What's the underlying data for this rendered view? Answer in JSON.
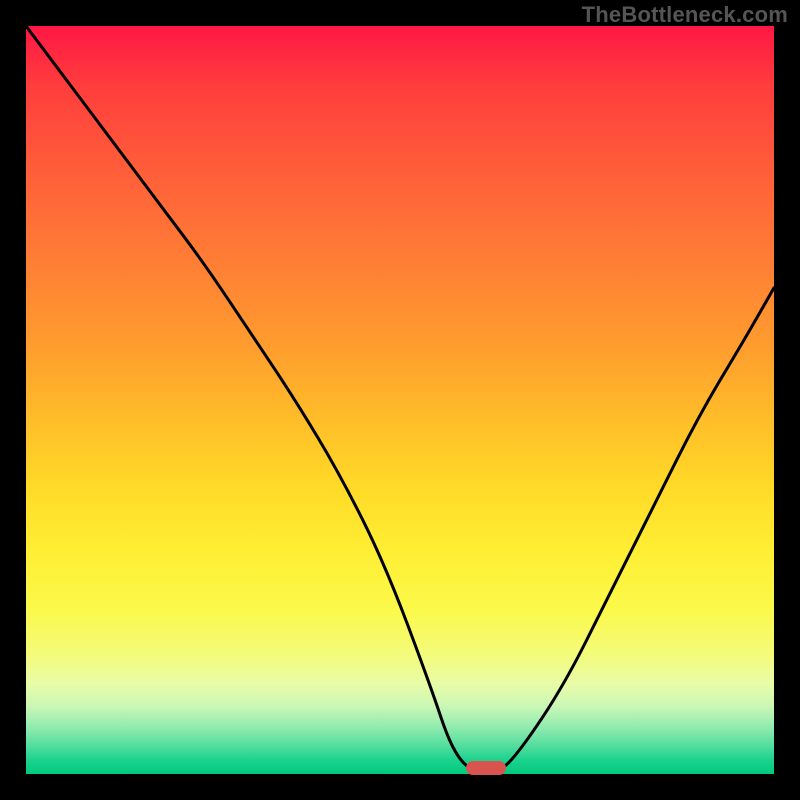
{
  "watermark": "TheBottleneck.com",
  "colors": {
    "frame": "#000000",
    "curve": "#000000",
    "marker": "#d9534f"
  },
  "chart_data": {
    "type": "line",
    "title": "",
    "xlabel": "",
    "ylabel": "",
    "xlim": [
      0,
      100
    ],
    "ylim": [
      0,
      100
    ],
    "grid": false,
    "legend": false,
    "series": [
      {
        "name": "bottleneck-curve",
        "x": [
          0,
          6,
          12,
          18,
          24,
          30,
          36,
          42,
          48,
          54,
          57,
          60,
          63,
          66,
          72,
          78,
          84,
          90,
          96,
          100
        ],
        "values": [
          100,
          92,
          84,
          76,
          68,
          59,
          50,
          40,
          28,
          12,
          3,
          0,
          0,
          3,
          12,
          24,
          36,
          48,
          58,
          65
        ]
      }
    ],
    "marker": {
      "x": 61.5,
      "y": 0.8
    }
  }
}
